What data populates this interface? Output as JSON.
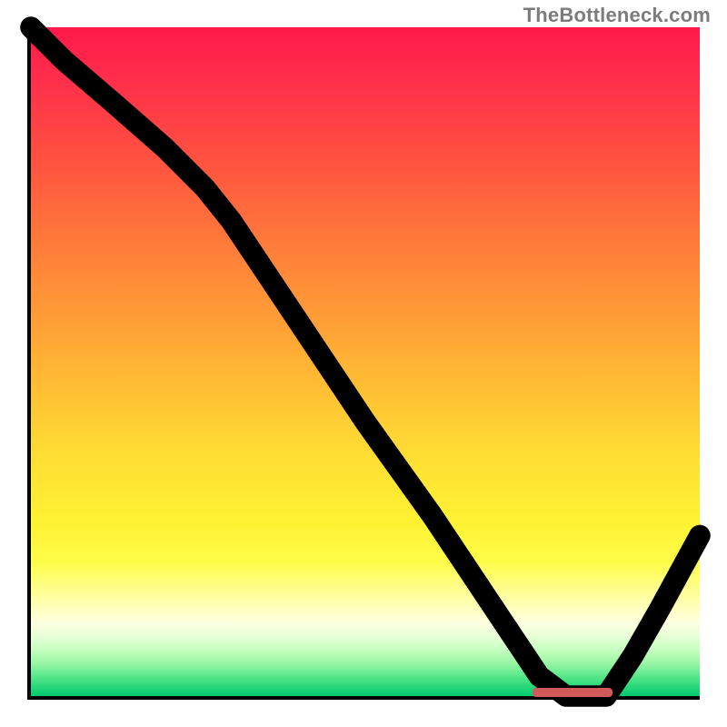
{
  "watermark": "TheBottleneck.com",
  "chart_data": {
    "type": "line",
    "title": "",
    "xlabel": "",
    "ylabel": "",
    "xlim": [
      0,
      100
    ],
    "ylim": [
      0,
      100
    ],
    "grid": false,
    "legend": false,
    "series": [
      {
        "name": "curve",
        "x": [
          0,
          5,
          12,
          20,
          26,
          30,
          40,
          50,
          60,
          68,
          74,
          76,
          80,
          86,
          90,
          94,
          100
        ],
        "values": [
          100,
          95,
          89,
          82,
          76,
          71,
          56,
          41,
          27,
          15,
          6,
          3,
          0,
          0,
          6,
          13,
          24
        ]
      }
    ],
    "annotations": [
      {
        "name": "optimal-range-marker",
        "x_start": 75,
        "x_end": 87,
        "y": 0,
        "color": "#d15a5a"
      }
    ],
    "background_gradient": {
      "direction": "vertical",
      "stops": [
        {
          "pos": 0,
          "color": "#ff1a4a"
        },
        {
          "pos": 50,
          "color": "#ffc234"
        },
        {
          "pos": 80,
          "color": "#fffd4a"
        },
        {
          "pos": 100,
          "color": "#00cc6a"
        }
      ]
    }
  }
}
